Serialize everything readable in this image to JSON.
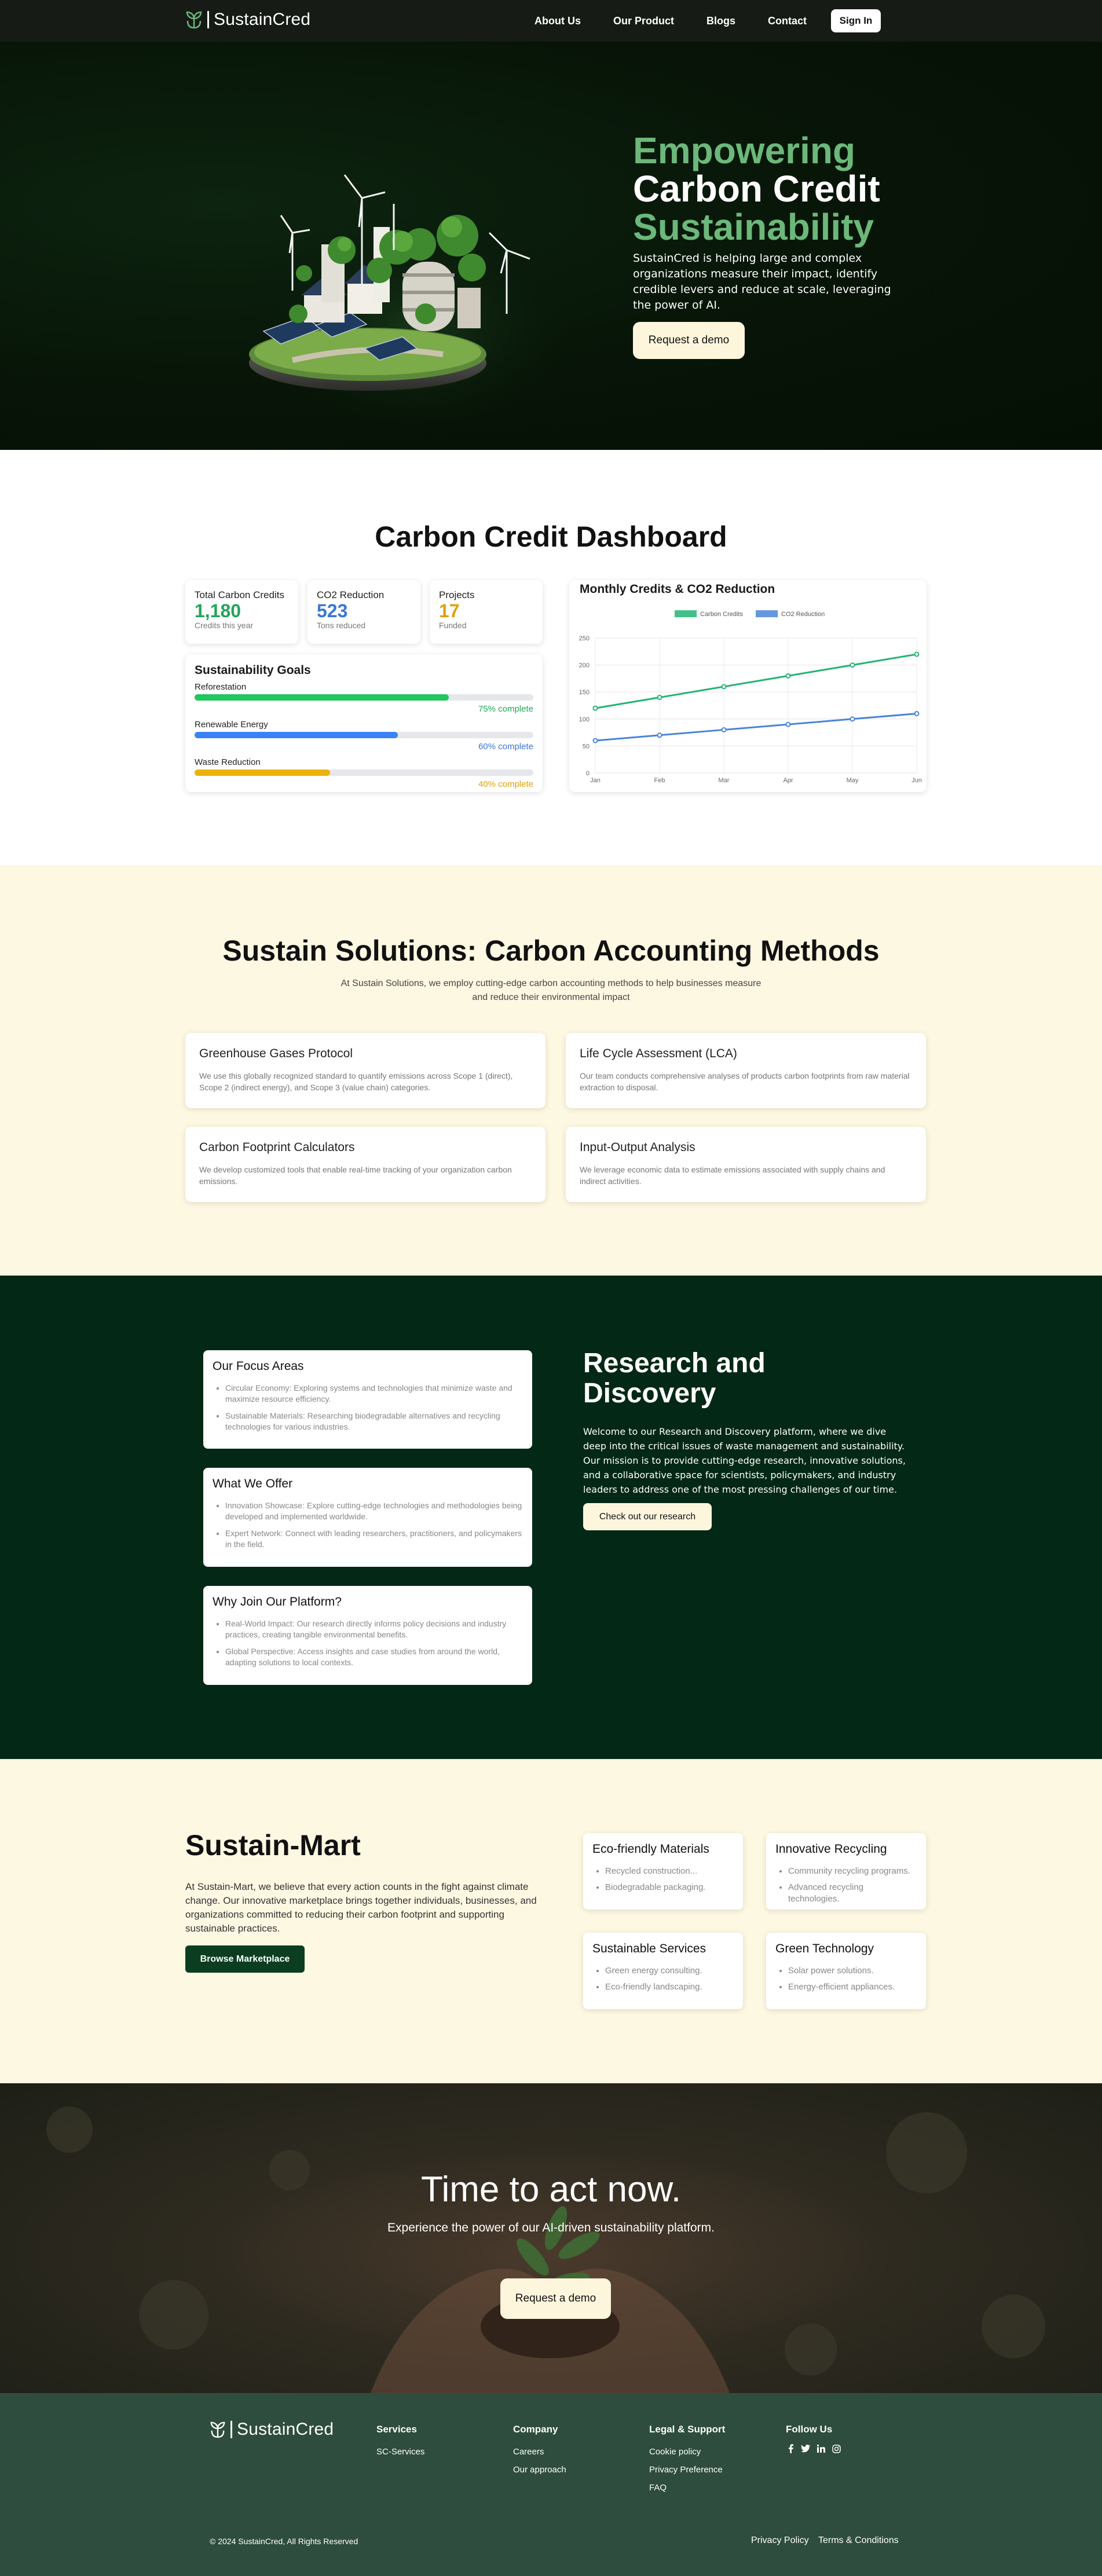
{
  "nav": {
    "brand": "SustainCred",
    "links": [
      "About Us",
      "Our Product",
      "Blogs",
      "Contact"
    ],
    "sign_in": "Sign In"
  },
  "hero": {
    "title_line1": "Empowering",
    "title_line2": "Carbon Credit",
    "title_line3": "Sustainability",
    "description": "SustainCred is helping large and complex organizations measure their impact, identify credible levers and reduce at scale, leveraging the power of AI.",
    "cta": "Request a demo"
  },
  "dashboard": {
    "title": "Carbon Credit Dashboard",
    "stats": [
      {
        "label": "Total Carbon Credits",
        "value": "1,180",
        "sub": "Credits this year",
        "color": "#22a55a"
      },
      {
        "label": "CO2 Reduction",
        "value": "523",
        "sub": "Tons reduced",
        "color": "#3b76d6"
      },
      {
        "label": "Projects",
        "value": "17",
        "sub": "Funded",
        "color": "#e0a10c"
      }
    ],
    "goals_title": "Sustainability Goals",
    "goals": [
      {
        "name": "Reforestation",
        "percent": 75,
        "label": "75% complete",
        "color": "#22c55e"
      },
      {
        "name": "Renewable Energy",
        "percent": 60,
        "label": "60% complete",
        "color": "#3b82f6"
      },
      {
        "name": "Waste Reduction",
        "percent": 40,
        "label": "40% complete",
        "color": "#eab308"
      }
    ]
  },
  "chart_data": {
    "type": "line",
    "title": "Monthly Credits & CO2 Reduction",
    "categories": [
      "Jan",
      "Feb",
      "Mar",
      "Apr",
      "May",
      "Jun"
    ],
    "series": [
      {
        "name": "Carbon Credits",
        "values": [
          120,
          140,
          160,
          180,
          200,
          220
        ],
        "color": "#22b573"
      },
      {
        "name": "CO2 Reduction",
        "values": [
          60,
          70,
          80,
          90,
          100,
          110
        ],
        "color": "#4a84d8"
      }
    ],
    "y_ticks": [
      0,
      50,
      100,
      150,
      200,
      250
    ],
    "ylim": [
      0,
      250
    ],
    "grid": true,
    "legend": "top-center"
  },
  "solutions": {
    "title": "Sustain Solutions: Carbon Accounting Methods",
    "subtitle_line1": "At Sustain Solutions, we employ cutting-edge carbon accounting methods to help businesses measure",
    "subtitle_line2": "and reduce their environmental impact",
    "cards": [
      {
        "title": "Greenhouse Gases Protocol",
        "text": "We use this globally recognized standard to quantify emissions across Scope 1 (direct), Scope 2 (indirect energy), and Scope 3 (value chain) categories."
      },
      {
        "title": "Life Cycle Assessment (LCA)",
        "text": "Our team conducts comprehensive analyses of products carbon footprints from raw material extraction to disposal."
      },
      {
        "title": "Carbon Footprint Calculators",
        "text": "We develop customized tools that enable real-time tracking of your organization carbon emissions."
      },
      {
        "title": "Input-Output Analysis",
        "text": "We leverage economic data to estimate emissions associated with supply chains and indirect activities."
      }
    ]
  },
  "research": {
    "title_line1": "Research and",
    "title_line2": "Discovery",
    "description": "Welcome to our Research and Discovery platform, where we dive deep into the critical issues of waste management and sustainability. Our mission is to provide cutting-edge research, innovative solutions, and a collaborative space for scientists, policymakers, and industry leaders to address one of the most pressing challenges of our time.",
    "cta": "Check out our research",
    "cards": [
      {
        "title": "Our Focus Areas",
        "items": [
          "Circular Economy: Exploring systems and technologies that minimize waste and maximize resource efficiency.",
          "Sustainable Materials: Researching biodegradable alternatives and recycling technologies for various industries."
        ]
      },
      {
        "title": "What We Offer",
        "items": [
          "Innovation Showcase: Explore cutting-edge technologies and methodologies being developed and implemented worldwide.",
          "Expert Network: Connect with leading researchers, practitioners, and policymakers in the field."
        ]
      },
      {
        "title": "Why Join Our Platform?",
        "items": [
          "Real-World Impact: Our research directly informs policy decisions and industry practices, creating tangible environmental benefits.",
          "Global Perspective: Access insights and case studies from around the world, adapting solutions to local contexts."
        ]
      }
    ]
  },
  "mart": {
    "title": "Sustain-Mart",
    "description": "At Sustain-Mart, we believe that every action counts in the fight against climate change. Our innovative marketplace brings together individuals, businesses, and organizations committed to reducing their carbon footprint and supporting sustainable practices.",
    "cta": "Browse Marketplace",
    "cards": [
      {
        "title": "Eco-friendly Materials",
        "items": [
          "Recycled construction...",
          "Biodegradable packaging."
        ]
      },
      {
        "title": "Innovative Recycling",
        "items": [
          "Community recycling programs.",
          "Advanced recycling technologies."
        ]
      },
      {
        "title": "Sustainable Services",
        "items": [
          "Green energy consulting.",
          "Eco-friendly landscaping."
        ]
      },
      {
        "title": "Green Technology",
        "items": [
          "Solar power solutions.",
          "Energy-efficient appliances."
        ]
      }
    ]
  },
  "cta": {
    "title": "Time to act now.",
    "subtitle": "Experience the power of our AI-driven sustainability platform.",
    "button": "Request a demo"
  },
  "footer": {
    "brand": "SustainCred",
    "services_title": "Services",
    "services": [
      "SC-Services"
    ],
    "company_title": "Company",
    "company": [
      "Careers",
      "Our approach"
    ],
    "legal_title": "Legal & Support",
    "legal": [
      "Cookie policy",
      "Privacy Preference",
      "FAQ"
    ],
    "follow_title": "Follow Us",
    "social_icons": [
      "facebook-icon",
      "twitter-icon",
      "linkedin-icon",
      "instagram-icon"
    ],
    "copyright": "© 2024 SustainCred, All Rights Reserved",
    "privacy": "Privacy Policy",
    "terms": "Terms & Conditions"
  }
}
